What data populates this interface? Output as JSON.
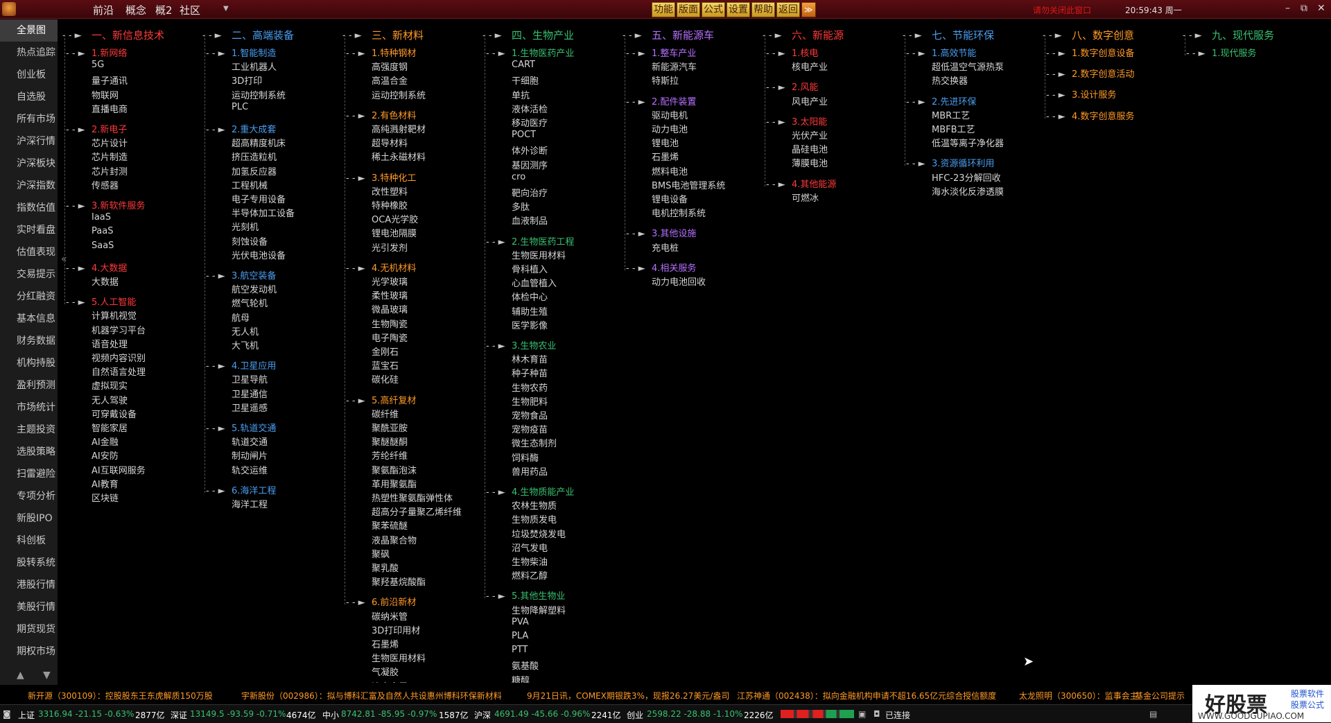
{
  "topbar": {
    "menus": [
      "前沿",
      "概念",
      "概2",
      "社区"
    ],
    "dropdown": "▼",
    "func_buttons": [
      "功能",
      "版面",
      "公式",
      "设置",
      "帮助",
      "返回"
    ],
    "func_more": "≫",
    "notice": "请勿关闭此窗口",
    "clock": "20:59:43 周一",
    "win_min": "–",
    "win_max": "⧉",
    "win_close": "✕"
  },
  "sidebar": {
    "items": [
      "全景图",
      "热点追踪",
      "创业板",
      "自选股",
      "所有市场",
      "沪深行情",
      "沪深板块",
      "沪深指数",
      "指数估值",
      "实时看盘",
      "估值表现",
      "交易提示",
      "分红融资",
      "基本信息",
      "财务数据",
      "机构持股",
      "盈利预测",
      "市场统计",
      "主题投资",
      "选股策略",
      "扫雷避险",
      "专项分析",
      "新股IPO",
      "科创板",
      "股转系统",
      "港股行情",
      "美股行情",
      "期货现货",
      "期权市场"
    ],
    "collapse": "«",
    "up": "▲",
    "down": "▼"
  },
  "columns": [
    {
      "title": "一、新信息技术",
      "color": "red",
      "groups": [
        {
          "name": "1.新网络",
          "color": "red",
          "items": [
            "5G",
            "量子通讯",
            "物联网",
            "直播电商"
          ]
        },
        {
          "name": "2.新电子",
          "color": "red",
          "items": [
            "芯片设计",
            "芯片制造",
            "芯片封测",
            "传感器"
          ]
        },
        {
          "name": "3.新软件服务",
          "color": "red",
          "items": [
            "IaaS",
            "PaaS",
            "SaaS"
          ]
        },
        {
          "name": "4.大数据",
          "color": "red",
          "items": [
            "大数据"
          ]
        },
        {
          "name": "5.人工智能",
          "color": "red",
          "items": [
            "计算机视觉",
            "机器学习平台",
            "语音处理",
            "视频内容识别",
            "自然语言处理",
            "虚拟现实",
            "无人驾驶",
            "可穿戴设备",
            "智能家居",
            "AI金融",
            "AI安防",
            "AI互联网服务",
            "AI教育",
            "区块链"
          ]
        }
      ]
    },
    {
      "title": "二、高端装备",
      "color": "blue",
      "groups": [
        {
          "name": "1.智能制造",
          "color": "blue",
          "items": [
            "工业机器人",
            "3D打印",
            "运动控制系统",
            "PLC"
          ]
        },
        {
          "name": "2.重大成套",
          "color": "blue",
          "items": [
            "超高精度机床",
            "挤压造粒机",
            "加氢反应器",
            "工程机械",
            "电子专用设备",
            "半导体加工设备",
            "光刻机",
            "刻蚀设备",
            "光伏电池设备"
          ]
        },
        {
          "name": "3.航空装备",
          "color": "blue",
          "items": [
            "航空发动机",
            "燃气轮机",
            "航母",
            "无人机",
            "大飞机"
          ]
        },
        {
          "name": "4.卫星应用",
          "color": "blue",
          "items": [
            "卫星导航",
            "卫星通信",
            "卫星遥感"
          ]
        },
        {
          "name": "5.轨道交通",
          "color": "blue",
          "items": [
            "轨道交通",
            "制动闸片",
            "轨交运维"
          ]
        },
        {
          "name": "6.海洋工程",
          "color": "blue",
          "items": [
            "海洋工程"
          ]
        }
      ]
    },
    {
      "title": "三、新材料",
      "color": "orange",
      "groups": [
        {
          "name": "1.特种钢材",
          "color": "orange",
          "items": [
            "高强度钢",
            "高温合金",
            "运动控制系统"
          ]
        },
        {
          "name": "2.有色材料",
          "color": "orange",
          "items": [
            "高纯溅射靶材",
            "超导材料",
            "稀土永磁材料"
          ]
        },
        {
          "name": "3.特种化工",
          "color": "orange",
          "items": [
            "改性塑料",
            "特种橡胶",
            "OCA光学胶",
            "锂电池隔膜",
            "光引发剂"
          ]
        },
        {
          "name": "4.无机材料",
          "color": "orange",
          "items": [
            "光学玻璃",
            "柔性玻璃",
            "微晶玻璃",
            "生物陶瓷",
            "电子陶瓷",
            "金刚石",
            "蓝宝石",
            "碳化硅"
          ]
        },
        {
          "name": "5.高纤复材",
          "color": "orange",
          "items": [
            "碳纤维",
            "聚酰亚胺",
            "聚醚醚酮",
            "芳纶纤维",
            "聚氨酯泡沫",
            "革用聚氨酯",
            "热塑性聚氨酯弹性体",
            "超高分子量聚乙烯纤维",
            "聚苯硫醚",
            "液晶聚合物",
            "聚砜",
            "聚乳酸",
            "聚羟基烷酸酯"
          ]
        },
        {
          "name": "6.前沿新材",
          "color": "orange",
          "items": [
            "碳纳米管",
            "3D打印用材",
            "石墨烯",
            "生物医用材料",
            "气凝胶",
            "液态金属"
          ]
        }
      ]
    },
    {
      "title": "四、生物产业",
      "color": "green",
      "groups": [
        {
          "name": "1.生物医药产业",
          "color": "green",
          "items": [
            "CART",
            "干细胞",
            "单抗",
            "液体活检",
            "移动医疗",
            "POCT",
            "体外诊断",
            "基因测序",
            "cro",
            "靶向治疗",
            "多肽",
            "血液制品"
          ]
        },
        {
          "name": "2.生物医药工程",
          "color": "green",
          "items": [
            "生物医用材料",
            "骨科植入",
            "心血管植入",
            "体检中心",
            "辅助生殖",
            "医学影像"
          ]
        },
        {
          "name": "3.生物农业",
          "color": "green",
          "items": [
            "林木育苗",
            "种子种苗",
            "生物农药",
            "生物肥料",
            "宠物食品",
            "宠物疫苗",
            "微生态制剂",
            "饲料酶",
            "兽用药品"
          ]
        },
        {
          "name": "4.生物质能产业",
          "color": "green",
          "items": [
            "农林生物质",
            "生物质发电",
            "垃圾焚烧发电",
            "沼气发电",
            "生物柴油",
            "燃料乙醇"
          ]
        },
        {
          "name": "5.其他生物业",
          "color": "green",
          "items": [
            "生物降解塑料",
            "PVA",
            "PLA",
            "PTT",
            "氨基酸",
            "糖醇"
          ]
        }
      ]
    },
    {
      "title": "五、新能源车",
      "color": "purple",
      "groups": [
        {
          "name": "1.整车产业",
          "color": "purple",
          "items": [
            "新能源汽车",
            "特斯拉"
          ]
        },
        {
          "name": "2.配件装置",
          "color": "purple",
          "items": [
            "驱动电机",
            "动力电池",
            "锂电池",
            "石墨烯",
            "燃料电池",
            "BMS电池管理系统",
            "锂电设备",
            "电机控制系统"
          ]
        },
        {
          "name": "3.其他设施",
          "color": "purple",
          "items": [
            "充电桩"
          ]
        },
        {
          "name": "4.相关服务",
          "color": "purple",
          "items": [
            "动力电池回收"
          ]
        }
      ]
    },
    {
      "title": "六、新能源",
      "color": "red",
      "groups": [
        {
          "name": "1.核电",
          "color": "red",
          "items": [
            "核电产业"
          ]
        },
        {
          "name": "2.风能",
          "color": "red",
          "items": [
            "风电产业"
          ]
        },
        {
          "name": "3.太阳能",
          "color": "red",
          "items": [
            "光伏产业",
            "晶硅电池",
            "薄膜电池"
          ]
        },
        {
          "name": "4.其他能源",
          "color": "red",
          "items": [
            "可燃冰"
          ]
        }
      ]
    },
    {
      "title": "七、节能环保",
      "color": "blue",
      "groups": [
        {
          "name": "1.高效节能",
          "color": "blue",
          "items": [
            "超低温空气源热泵",
            "热交换器"
          ]
        },
        {
          "name": "2.先进环保",
          "color": "blue",
          "items": [
            "MBR工艺",
            "MBFB工艺",
            "低温等离子净化器"
          ]
        },
        {
          "name": "3.资源循环利用",
          "color": "blue",
          "items": [
            "HFC-23分解回收",
            "海水淡化反渗透膜"
          ]
        }
      ]
    },
    {
      "title": "八、数字创意",
      "color": "orange",
      "groups": [
        {
          "name": "1.数字创意设备",
          "color": "orange",
          "items": []
        },
        {
          "name": "2.数字创意活动",
          "color": "orange",
          "items": []
        },
        {
          "name": "3.设计服务",
          "color": "orange",
          "items": []
        },
        {
          "name": "4.数字创意服务",
          "color": "orange",
          "items": []
        }
      ]
    },
    {
      "title": "九、现代服务",
      "color": "green",
      "groups": [
        {
          "name": "1.现代服务",
          "color": "green",
          "items": []
        }
      ]
    }
  ],
  "ticker": [
    "新开源（300109）：控股股东王东虎解质150万股",
    "宇新股份（002986）：拟与博科汇富及自然人共设惠州博科环保新材料",
    "9月21日讯，COMEX期银跌3%，现报26.27美元/盎司",
    "江苏神通（002438）：拟向金融机构申请不超16.65亿元综合授信额度",
    "太龙照明（300650）：监事会主",
    "基金公司提示"
  ],
  "status": {
    "sh_label": "上证",
    "sh_vals": "3316.94  -21.15  -0.63%",
    "sh_amt": "2877亿",
    "sz_label": "深证",
    "sz_vals": "13149.5  -93.59  -0.71%",
    "sz_amt": "4674亿",
    "zx_label": "中小",
    "zx_vals": "8742.81  -85.95  -0.97%",
    "zx_amt": "1587亿",
    "hs_label": "沪深",
    "hs_vals": "4691.49  -45.66  -0.96%",
    "hs_amt": "2241亿",
    "cy_label": "创业",
    "cy_vals": "2598.22  -28.88  -1.10%",
    "cy_amt": "2226亿",
    "connected": "已连接"
  },
  "logo": {
    "main": "好股票",
    "side1": "股票软件",
    "side2": "股票公式",
    "url": "WWW.GOODGUPIAO.COM"
  },
  "colors": {
    "red": "#ff3a3a",
    "blue": "#4a9ef0",
    "orange": "#ff9a28",
    "green": "#38c070",
    "purple": "#b670ff",
    "up": "#ff3a3a",
    "down": "#38c070"
  }
}
